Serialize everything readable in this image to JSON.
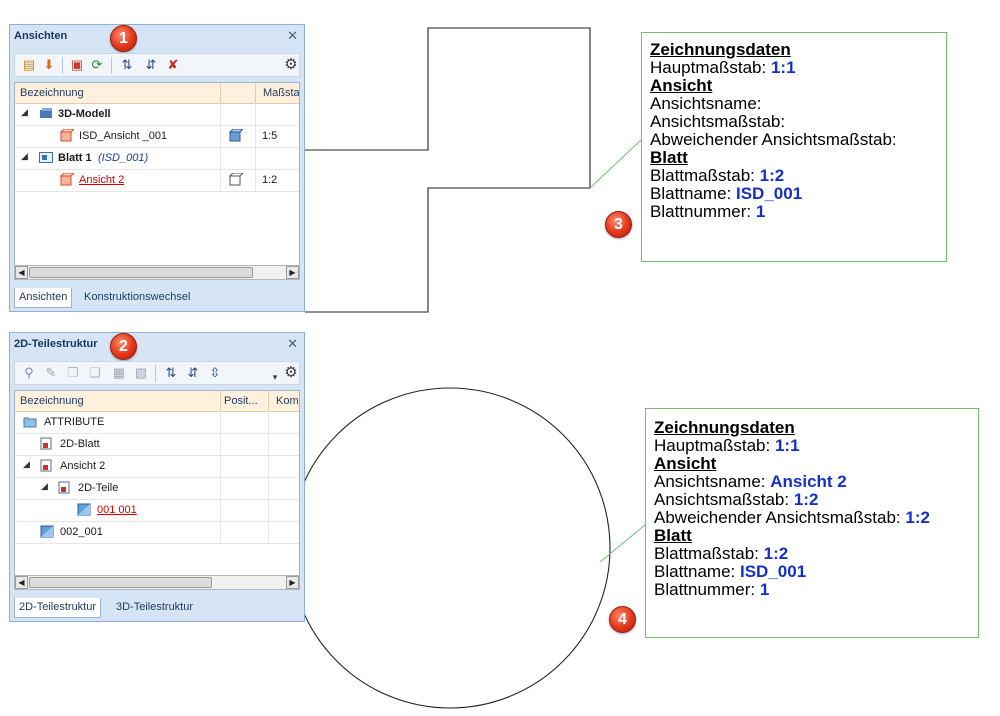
{
  "colors": {
    "panel_bg": "#d6e5f5",
    "header_bg": "#fdf0dc",
    "link_red": "#d40000",
    "value_blue": "#1530c8",
    "leader_green": "#6fbf6f",
    "badge_red": "#e2361a"
  },
  "panel1": {
    "title": "Ansichten",
    "badge": "1",
    "close_icon": "close-icon",
    "toolbar_icons": [
      "new-view-icon",
      "import-arrow-icon",
      "view-frame-icon",
      "refresh-icon",
      "sort-up-icon",
      "sort-down-icon",
      "delete-icon",
      "gear-icon"
    ],
    "columns": [
      "Bezeichnung",
      "Maßsta"
    ],
    "rows": [
      {
        "label": "3D-Modell",
        "scale": "",
        "icon": "model-3d-icon"
      },
      {
        "label": "ISD_Ansicht _001",
        "scale": "1:5",
        "icon": "view-icon"
      },
      {
        "label": "Blatt 1",
        "label_suffix": "(ISD_001)",
        "scale": "",
        "icon": "sheet-icon"
      },
      {
        "label": "Ansicht 2",
        "scale": "1:2",
        "icon": "view-icon"
      }
    ],
    "tabs": [
      "Ansichten",
      "Konstruktionswechsel"
    ]
  },
  "panel2": {
    "title": "2D-Teilestruktur",
    "badge": "2",
    "close_icon": "close-icon",
    "toolbar_icons": [
      "find-icon",
      "pick-icon",
      "copy-icon",
      "clipboard-icon",
      "paste-icon",
      "paste-special-icon",
      "sort-icon",
      "sort-num-icon",
      "sort-num2-icon",
      "dropdown-icon",
      "gear-icon"
    ],
    "columns": [
      "Bezeichnung",
      "Posit...",
      "Kom"
    ],
    "rows": [
      {
        "label": "ATTRIBUTE",
        "icon": "folder-icon"
      },
      {
        "label": "2D-Blatt",
        "icon": "sheet-2d-icon"
      },
      {
        "label": "Ansicht 2",
        "icon": "view-2d-icon"
      },
      {
        "label": "2D-Teile",
        "icon": "parts-2d-icon"
      },
      {
        "label": "001 001",
        "icon": "part-icon"
      },
      {
        "label": "002_001",
        "icon": "part-icon"
      }
    ],
    "tabs": [
      "2D-Teilestruktur",
      "3D-Teilestruktur"
    ]
  },
  "box3": {
    "badge": "3",
    "heading1": "Zeichnungsdaten",
    "haupt_label": "Hauptmaßstab: ",
    "haupt_value": "1:1",
    "heading2": "Ansicht",
    "ansname_label": "Ansichtsname:",
    "ansname_value": "",
    "ansmass_label": "Ansichtsmaßstab:",
    "ansmass_value": "",
    "abw_label": "Abweichender Ansichtsmaßstab:",
    "abw_value": "",
    "heading3": "Blatt",
    "blattmass_label": "Blattmaßstab: ",
    "blattmass_value": "1:2",
    "blattname_label": "Blattname: ",
    "blattname_value": "ISD_001",
    "blattnr_label": "Blattnummer: ",
    "blattnr_value": "1"
  },
  "box4": {
    "badge": "4",
    "heading1": "Zeichnungsdaten",
    "haupt_label": "Hauptmaßstab: ",
    "haupt_value": "1:1",
    "heading2": "Ansicht",
    "ansname_label": "Ansichtsname: ",
    "ansname_value": "Ansicht 2",
    "ansmass_label": "Ansichtsmaßstab: ",
    "ansmass_value": "1:2",
    "abw_label": "Abweichender Ansichtsmaßstab: ",
    "abw_value": "1:2",
    "heading3": "Blatt",
    "blattmass_label": "Blattmaßstab: ",
    "blattmass_value": "1:2",
    "blattname_label": "Blattname: ",
    "blattname_value": "ISD_001",
    "blattnr_label": "Blattnummer: ",
    "blattnr_value": "1"
  }
}
